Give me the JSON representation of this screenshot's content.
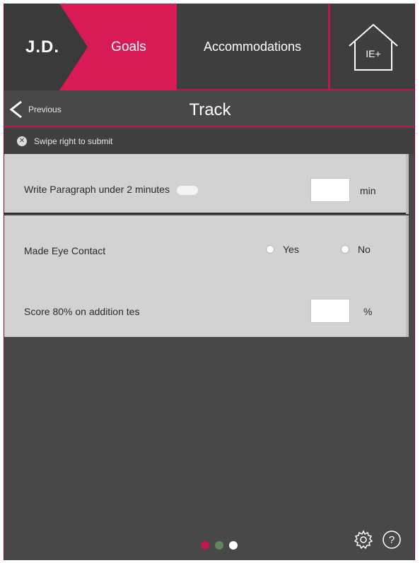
{
  "nav": {
    "initials": "J.D.",
    "goals_label": "Goals",
    "accommodations_label": "Accommodations",
    "home_label": "IE+"
  },
  "header": {
    "back_label": "Previous",
    "title": "Track"
  },
  "hint": {
    "text": "Swipe right to submit"
  },
  "goals": [
    {
      "label": "Write Paragraph under 2 minutes",
      "value": "",
      "unit": "min"
    },
    {
      "label": "Made Eye Contact",
      "options": [
        "Yes",
        "No"
      ]
    },
    {
      "label": "Score 80% on addition tes",
      "value": "",
      "unit": "%"
    }
  ],
  "colors": {
    "accent": "#d81b55",
    "background": "#484848",
    "panel": "#d2d2d2"
  },
  "pager": {
    "pages": 3,
    "current": 3
  }
}
